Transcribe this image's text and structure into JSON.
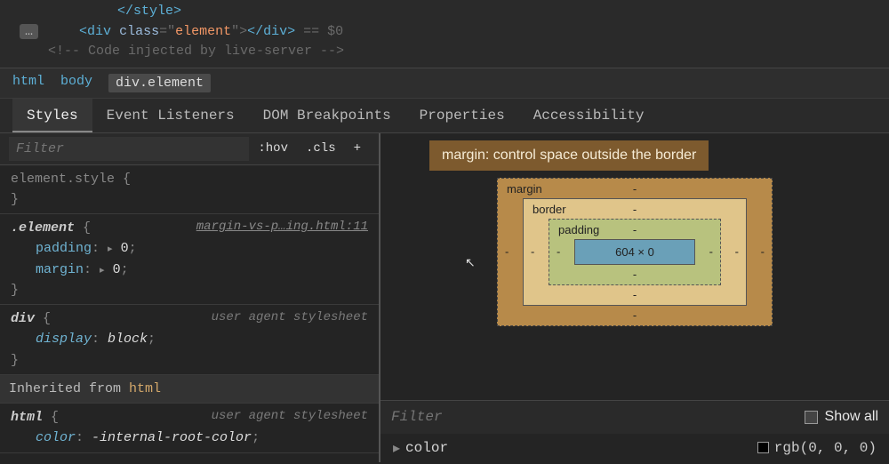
{
  "code": {
    "closing_style": "</style>",
    "ellipsis": "…",
    "line_prefix": "    ",
    "open_angle": "<",
    "div": "div ",
    "class_attr": "class",
    "eq": "=\"",
    "class_val": "element",
    "close_attr": "\">",
    "close_tag": "</",
    "div2": "div",
    "gt": ">",
    "eq_dollar": " == $0",
    "injected": "<!-- Code injected by live-server -->"
  },
  "breadcrumbs": {
    "html": "html",
    "body": "body",
    "current": "div.element"
  },
  "tabs": {
    "styles": "Styles",
    "event_listeners": "Event Listeners",
    "dom_breakpoints": "DOM Breakpoints",
    "properties": "Properties",
    "accessibility": "Accessibility"
  },
  "filter": {
    "placeholder": "Filter",
    "hov": ":hov",
    "cls": ".cls"
  },
  "rules": {
    "element_style": "element.style {",
    "close": "}",
    "element_sel": ".element",
    "open": " {",
    "source": "margin-vs-p…ing.html:11",
    "padding_k": "padding",
    "padding_v": "0",
    "margin_k": "margin",
    "margin_v": "0",
    "colon": ": ",
    "semicolon": ";",
    "div_sel": "div",
    "ua": "user agent stylesheet",
    "display_k": "display",
    "display_v": "block",
    "inherited_label": "Inherited from ",
    "inherited_el": "html",
    "html_sel": "html",
    "color_k": "color",
    "color_v": "-internal-root-color",
    "tri": "▸"
  },
  "tooltip": "margin: control space outside the border",
  "boxmodel": {
    "margin": "margin",
    "border": "border",
    "padding": "padding",
    "dash": "-",
    "content": "604 × 0"
  },
  "computed": {
    "filter": "Filter",
    "showall": "Show all",
    "color_label": "color",
    "color_value": "rgb(0, 0, 0)",
    "tri": "▸"
  }
}
